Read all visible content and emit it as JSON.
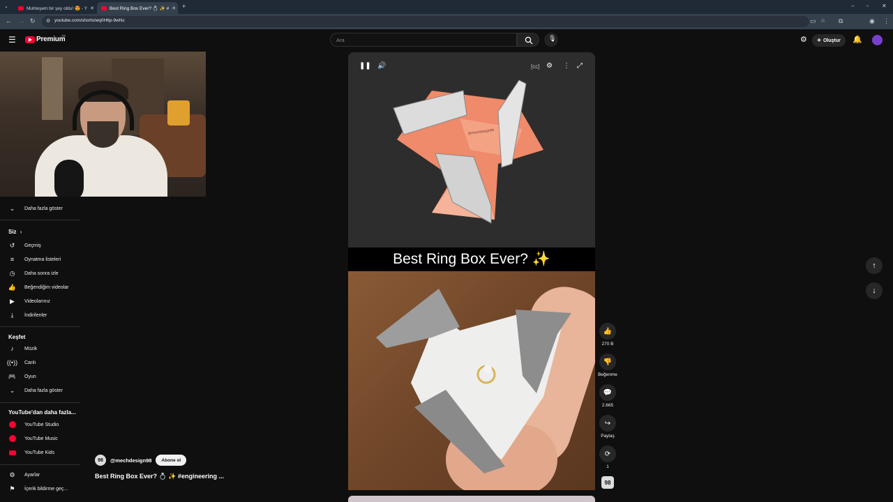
{
  "browser": {
    "tabs": [
      {
        "title": "Muhteşem bir şey oldu! 😍 - Y"
      },
      {
        "title": "Best Ring Box Ever? 💍 ✨ #"
      }
    ],
    "url": "youtube.com/shorts/wq0H6p-9wNc"
  },
  "header": {
    "logo": "Premium",
    "logo_region": "TR",
    "search_placeholder": "Ara",
    "create_label": "Oluştur"
  },
  "sidebar": {
    "more_top": "Daha fazla göster",
    "you_heading": "Siz",
    "you_items": [
      {
        "label": "Geçmiş",
        "icon": "history-icon"
      },
      {
        "label": "Oynatma listeleri",
        "icon": "playlists-icon"
      },
      {
        "label": "Daha sonra izle",
        "icon": "watch-later-icon"
      },
      {
        "label": "Beğendiğim videolar",
        "icon": "liked-icon"
      },
      {
        "label": "Videolarınız",
        "icon": "your-videos-icon"
      },
      {
        "label": "İndirilenler",
        "icon": "downloads-icon"
      }
    ],
    "explore_heading": "Keşfet",
    "explore_items": [
      {
        "label": "Müzik",
        "icon": "music-icon"
      },
      {
        "label": "Canlı",
        "icon": "live-icon"
      },
      {
        "label": "Oyun",
        "icon": "gaming-icon"
      },
      {
        "label": "Daha fazla göster",
        "icon": "chevron-down-icon"
      }
    ],
    "more_heading": "YouTube'dan daha fazla...",
    "more_items": [
      {
        "label": "YouTube Studio"
      },
      {
        "label": "YouTube Music"
      },
      {
        "label": "YouTube Kids"
      }
    ],
    "settings_items": [
      {
        "label": "Ayarlar",
        "icon": "settings-icon"
      },
      {
        "label": "İçerik bildirme geç...",
        "icon": "flag-icon"
      }
    ]
  },
  "video": {
    "overlay_title": "Best Ring Box Ever? ✨",
    "watermark": "@mechdesign98"
  },
  "actions": {
    "like_count": "270 B",
    "dislike_label": "Beğenme",
    "comment_count": "2.665",
    "share_label": "Paylaş",
    "remix_count": "1"
  },
  "channel": {
    "avatar_text": "98",
    "name": "@mechdesign98",
    "subscribe_label": "Abone ol",
    "video_title": "Best Ring Box Ever? 💍 ✨ #engineering ..."
  }
}
